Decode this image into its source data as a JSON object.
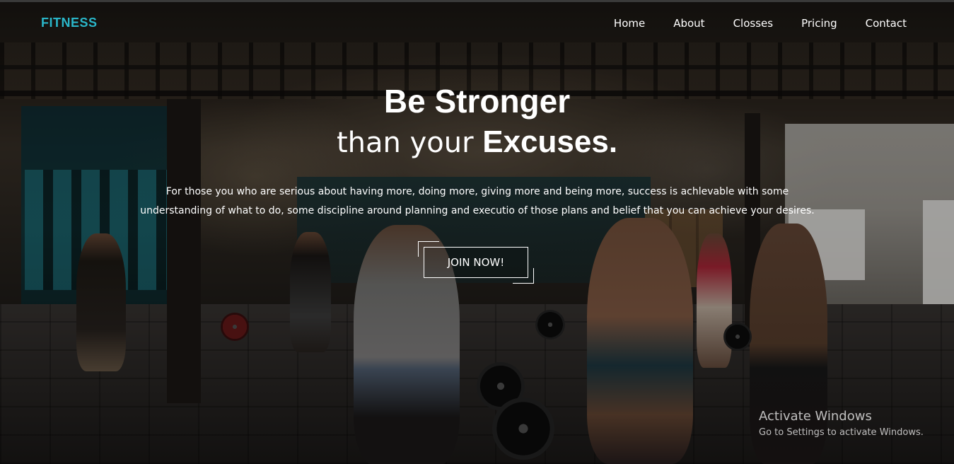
{
  "brand": {
    "logo": "FITNESS",
    "accent_color": "#2ab6c9"
  },
  "nav": {
    "items": [
      {
        "label": "Home"
      },
      {
        "label": "About"
      },
      {
        "label": "Closses"
      },
      {
        "label": "Pricing"
      },
      {
        "label": "Contact"
      }
    ]
  },
  "hero": {
    "title_line1": "Be Stronger",
    "title_line2_light": "than your ",
    "title_line2_bold": "Excuses.",
    "description_line1": "For those you who are serious about having more, doing more, giving more and being more, success is achlevable with some",
    "description_line2": "understanding of what to do, some discipline around planning and executio of those plans and belief that you can achieve your desires.",
    "cta_label": "JOIN NOW!",
    "background": "gym-photo"
  },
  "watermark": {
    "title": "Activate Windows",
    "subtitle": "Go to Settings to activate Windows."
  }
}
